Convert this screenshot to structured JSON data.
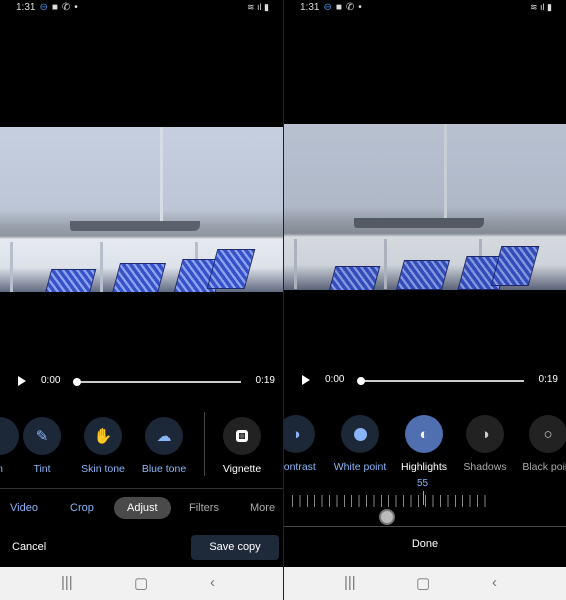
{
  "left": {
    "status": {
      "time": "1:31"
    },
    "player": {
      "current": "0:00",
      "duration": "0:19",
      "progress": 0
    },
    "tools": [
      {
        "label": "Tint",
        "icon": "eyedropper-icon"
      },
      {
        "label": "Skin tone",
        "icon": "hand-icon"
      },
      {
        "label": "Blue tone",
        "icon": "cloud-icon"
      },
      {
        "label": "Vignette",
        "icon": "vignette-icon"
      }
    ],
    "tabs": [
      "Video",
      "Crop",
      "Adjust",
      "Filters",
      "More"
    ],
    "active_tab": "Adjust",
    "cancel": "Cancel",
    "save": "Save copy"
  },
  "right": {
    "status": {
      "time": "1:31"
    },
    "player": {
      "current": "0:00",
      "duration": "0:19",
      "progress": 0
    },
    "tools": [
      {
        "label": "Contrast",
        "icon": "contrast-icon"
      },
      {
        "label": "White point",
        "icon": "white-point-icon"
      },
      {
        "label": "Highlights",
        "icon": "highlights-icon"
      },
      {
        "label": "Shadows",
        "icon": "shadows-icon"
      },
      {
        "label": "Black point",
        "icon": "black-point-icon"
      }
    ],
    "active_tool": "Highlights",
    "slider_value": "55",
    "done": "Done"
  },
  "colors": {
    "accent": "#8ab4f8",
    "active_circle": "#4f6fb0",
    "save_bg": "#1e2a3a"
  }
}
